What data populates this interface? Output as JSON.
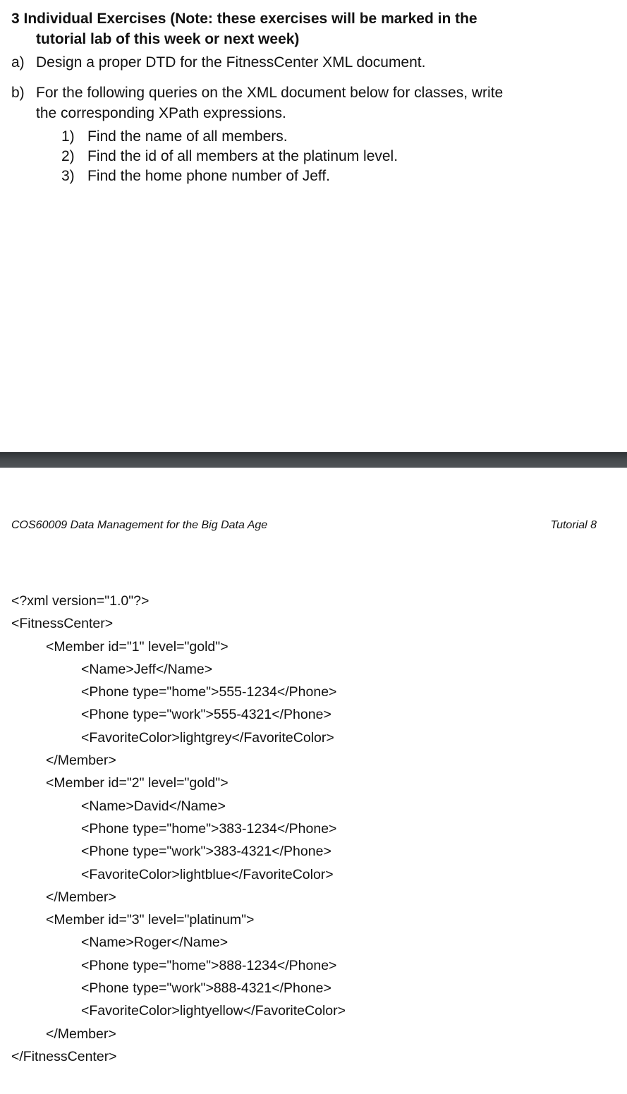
{
  "section": {
    "heading_line1": "3 Individual Exercises (Note: these exercises will be marked in the",
    "heading_line2": "tutorial lab of this week or next week)",
    "items": [
      {
        "marker": "a)",
        "lines": [
          "Design a proper DTD for the FitnessCenter XML document."
        ]
      },
      {
        "marker": "b)",
        "lines": [
          "For the following queries on the XML document below for classes, write",
          "the corresponding XPath expressions."
        ]
      }
    ],
    "queries": [
      {
        "marker": "1)",
        "text": "Find the name of all members."
      },
      {
        "marker": "2)",
        "text": "Find the id of all members at the platinum level."
      },
      {
        "marker": "3)",
        "text": "Find the home phone number of Jeff."
      }
    ]
  },
  "running_header": {
    "course": "COS60009 Data Management for the Big Data Age",
    "tutorial": "Tutorial 8"
  },
  "xml_document": {
    "lines": [
      {
        "indent": 0,
        "text": "<?xml version=\"1.0\"?>"
      },
      {
        "indent": 0,
        "text": "<FitnessCenter>"
      },
      {
        "indent": 1,
        "text": "<Member id=\"1\" level=\"gold\">"
      },
      {
        "indent": 2,
        "text": "<Name>Jeff</Name>"
      },
      {
        "indent": 2,
        "text": "<Phone type=\"home\">555-1234</Phone>"
      },
      {
        "indent": 2,
        "text": "<Phone type=\"work\">555-4321</Phone>"
      },
      {
        "indent": 2,
        "text": "<FavoriteColor>lightgrey</FavoriteColor>"
      },
      {
        "indent": 1,
        "text": "</Member>"
      },
      {
        "indent": 1,
        "text": "<Member id=\"2\" level=\"gold\">"
      },
      {
        "indent": 2,
        "text": "<Name>David</Name>"
      },
      {
        "indent": 2,
        "text": "<Phone type=\"home\">383-1234</Phone>"
      },
      {
        "indent": 2,
        "text": "<Phone type=\"work\">383-4321</Phone>"
      },
      {
        "indent": 2,
        "text": "<FavoriteColor>lightblue</FavoriteColor>"
      },
      {
        "indent": 1,
        "text": "</Member>"
      },
      {
        "indent": 1,
        "text": "<Member id=\"3\" level=\"platinum\">"
      },
      {
        "indent": 2,
        "text": "<Name>Roger</Name>"
      },
      {
        "indent": 2,
        "text": "<Phone type=\"home\">888-1234</Phone>"
      },
      {
        "indent": 2,
        "text": "<Phone type=\"work\">888-4321</Phone>"
      },
      {
        "indent": 2,
        "text": "<FavoriteColor>lightyellow</FavoriteColor>"
      },
      {
        "indent": 1,
        "text": "</Member>"
      },
      {
        "indent": 0,
        "text": "</FitnessCenter>"
      }
    ]
  },
  "colors": {
    "text": "#111111",
    "page_background": "#ffffff",
    "page_divider": "#44484b"
  }
}
